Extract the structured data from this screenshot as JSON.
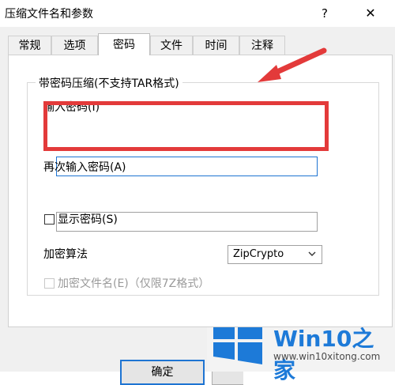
{
  "window": {
    "title": "压缩文件名和参数",
    "help_label": "?",
    "close_label": "✕"
  },
  "tabs": [
    {
      "label": "常规",
      "active": false
    },
    {
      "label": "选项",
      "active": false
    },
    {
      "label": "密码",
      "active": true
    },
    {
      "label": "文件",
      "active": false
    },
    {
      "label": "时间",
      "active": false
    },
    {
      "label": "注释",
      "active": false
    }
  ],
  "password_group": {
    "title": "带密码压缩(不支持TAR格式)",
    "enter_label": "输入密码(I)",
    "enter_value": "",
    "reenter_label": "再次输入密码(A)",
    "reenter_value": "",
    "show_password_label": "显示密码(S)",
    "show_password_checked": false,
    "encryption_label": "加密算法",
    "encryption_value": "ZipCrypto",
    "encrypt_names_label": "加密文件名(E)（仅限7Z格式）",
    "encrypt_names_checked": false,
    "encrypt_names_enabled": false
  },
  "buttons": {
    "ok_label": "确定"
  },
  "annotations": {
    "highlight_color": "#e33a3a"
  },
  "watermark": {
    "brand_latin": "Win10",
    "brand_cjk": "之家",
    "url": "www.win10xitong.com"
  },
  "colors": {
    "accent": "#1e74d2",
    "panel": "#f0f0f0"
  }
}
